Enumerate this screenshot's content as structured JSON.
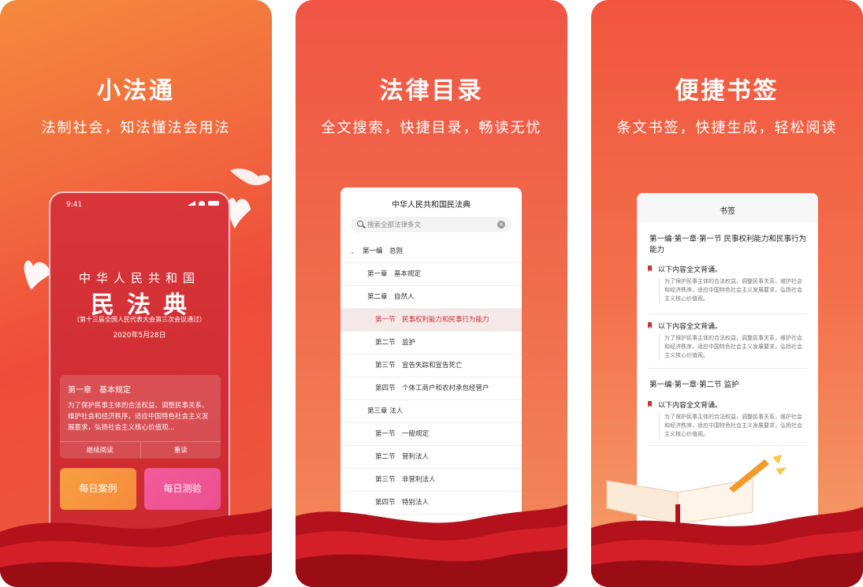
{
  "panels": [
    {
      "title": "小法通",
      "subtitle": "法制社会，知法懂法会用法",
      "phone": {
        "time": "9:41",
        "law_country": "中华人民共和国",
        "law_name": "民法典",
        "law_note": "（第十三届全国人民代表大会第三次会议通过）",
        "law_date": "2020年5月28日",
        "card": {
          "title": "第一章　基本规定",
          "body": "为了保护民事主体的合法权益、调整民事关系、维护社会和经济秩序，适应中国特色社会主义发展要求，弘扬社会主义核心价值观...",
          "continue_label": "继续阅读",
          "reread_label": "重读"
        },
        "daily_case_label": "每日案例",
        "daily_quiz_label": "每日测验"
      }
    },
    {
      "title": "法律目录",
      "subtitle": "全文搜索，快捷目录，畅读无忧",
      "window": {
        "title": "中华人民共和国民法典",
        "search_placeholder": "搜索全部法律条文",
        "toc": [
          {
            "label": "第一编　总则",
            "level": 0
          },
          {
            "label": "第一章　基本规定",
            "level": 1
          },
          {
            "label": "第二章　自然人",
            "level": 1
          },
          {
            "label": "第一节　民事权利能力和民事行为能力",
            "level": 2,
            "active": true
          },
          {
            "label": "第二节　监护",
            "level": 2
          },
          {
            "label": "第三节　宣告失踪和宣告死亡",
            "level": 2
          },
          {
            "label": "第四节　个体工商户和农村承包经营户",
            "level": 2
          },
          {
            "label": "第三章 法人",
            "level": 1
          },
          {
            "label": "第一节　一般规定",
            "level": 2
          },
          {
            "label": "第二节　营利法人",
            "level": 2
          },
          {
            "label": "第三节　非营利法人",
            "level": 2
          },
          {
            "label": "第四节　特别法人",
            "level": 2
          }
        ]
      }
    },
    {
      "title": "便捷书签",
      "subtitle": "条文书签，快捷生成，轻松阅读",
      "window": {
        "title": "书签",
        "sections": [
          {
            "heading": "第一编·第一章·第一节 民事权利能力和民事行为能力",
            "items": [
              {
                "label": "以下内容全文背诵。",
                "quote": "为了保护民事主体的合法权益，调整民事关系，维护社会和经济秩序，适应中国特色社会主义发展要求，弘扬社会主义核心价值观。"
              },
              {
                "label": "以下内容全文背诵。",
                "quote": "为了保护民事主体的合法权益，调整民事关系，维护社会和经济秩序，适应中国特色社会主义发展要求，弘扬社会主义核心价值观。"
              }
            ]
          },
          {
            "heading": "第一编·第一章·第二节 监护",
            "items": [
              {
                "label": "以下内容全文背诵。",
                "quote": "为了保护民事主体的合法权益，调整民事关系，维护社会和经济秩序，适应中国特色社会主义发展要求，弘扬社会主义核心价值观。"
              }
            ]
          }
        ]
      }
    }
  ],
  "colors": {
    "primary_red": "#c8333a",
    "panel_orange": "#f48a3c",
    "quiz_pink": "#ec4f8f"
  },
  "icons": [
    "signal-icon",
    "wifi-icon",
    "battery-icon",
    "search-icon",
    "clear-icon",
    "chevron-down-icon",
    "bookmark-icon",
    "dove-icon",
    "book-icon",
    "pencil-icon"
  ]
}
